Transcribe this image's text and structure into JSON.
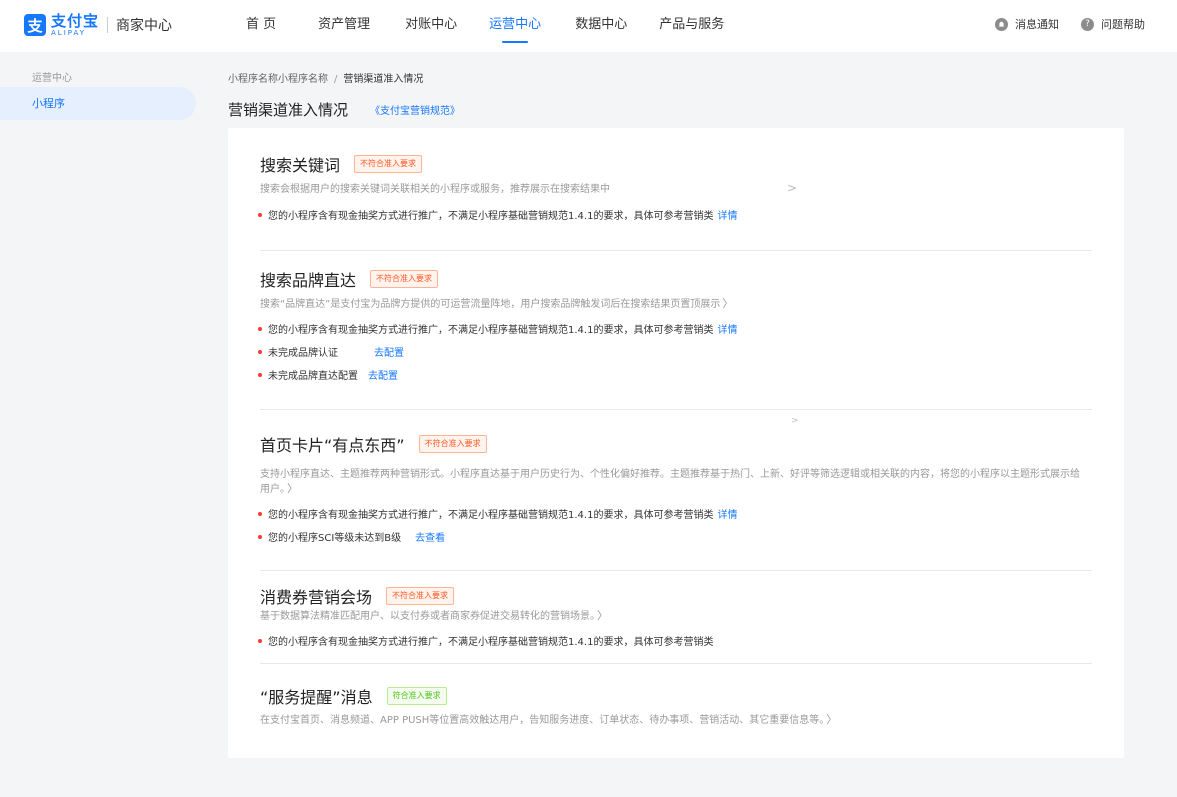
{
  "header": {
    "logo_mark": "支",
    "logo_cn": "支付宝",
    "logo_en": "ALIPAY",
    "product": "商家中心",
    "nav": [
      {
        "label": "首 页",
        "active": false
      },
      {
        "label": "资产管理",
        "active": false
      },
      {
        "label": "对账中心",
        "active": false
      },
      {
        "label": "运营中心",
        "active": true
      },
      {
        "label": "数据中心",
        "active": false
      },
      {
        "label": "产品与服务",
        "active": false
      }
    ],
    "notifications": "消息通知",
    "help": "问题帮助",
    "help_glyph": "?"
  },
  "sidebar": {
    "heading": "运营中心",
    "item": "小程序"
  },
  "breadcrumb": {
    "parent": "小程序名称小程序名称",
    "separator": "/",
    "current": "营销渠道准入情况"
  },
  "page": {
    "title": "营销渠道准入情况",
    "spec_link": "《支付宝营销规范》"
  },
  "sections": [
    {
      "title": "搜索关键词",
      "badge": "不符合准入要求",
      "desc": "搜索会根据用户的搜索关键词关联相关的小程序或服务，推荐展示在搜索结果中",
      "bullets": [
        {
          "text": "您的小程序含有现金抽奖方式进行推广，不满足小程序基础营销规范1.4.1的要求，具体可参考营销类",
          "link": "详情"
        }
      ]
    },
    {
      "title": "搜索品牌直达",
      "badge": "不符合准入要求",
      "desc": "搜索“品牌直达”是支付宝为品牌方提供的可运营流量阵地，用户搜索品牌触发词后在搜索结果页置顶展示",
      "bullets": [
        {
          "text": "您的小程序含有现金抽奖方式进行推广，不满足小程序基础营销规范1.4.1的要求，具体可参考营销类",
          "link": "详情"
        },
        {
          "text": "未完成品牌认证",
          "link": "去配置"
        },
        {
          "text": "未完成品牌直达配置",
          "link": "去配置"
        }
      ]
    },
    {
      "title": "首页卡片“有点东西”",
      "badge": "不符合准入要求",
      "desc": "支持小程序直达、主题推荐两种营销形式。小程序直达基于用户历史行为、个性化偏好推荐。主题推荐基于热门、上新、好评等筛选逻辑或相关联的内容，将您的小程序以主题形式展示给用户。",
      "bullets": [
        {
          "text": "您的小程序含有现金抽奖方式进行推广，不满足小程序基础营销规范1.4.1的要求，具体可参考营销类",
          "link": "详情"
        },
        {
          "text": "您的小程序SCI等级未达到B级",
          "link": "去查看"
        }
      ]
    },
    {
      "title": "消费券营销会场",
      "badge": "不符合准入要求",
      "desc": "基于数据算法精准匹配用户、以支付券或者商家券促进交易转化的营销场景。",
      "bullets": [
        {
          "text": "您的小程序含有现金抽奖方式进行推广，不满足小程序基础营销规范1.4.1的要求，具体可参考营销类",
          "link": ""
        }
      ]
    },
    {
      "title": "“服务提醒”消息",
      "badge": "符合准入要求",
      "desc": "在支付宝首页、消息频道、APP PUSH等位置高效触达用户，告知服务进度、订单状态、待办事项、营销活动、其它重要信息等。",
      "bullets": []
    }
  ],
  "glyphs": {
    "chevron": "〉",
    "chevron_small": ">"
  },
  "colors": {
    "accent": "#1677ff",
    "warning": "#ff5722",
    "success": "#52c41a",
    "bullet": "#ff3b30"
  }
}
